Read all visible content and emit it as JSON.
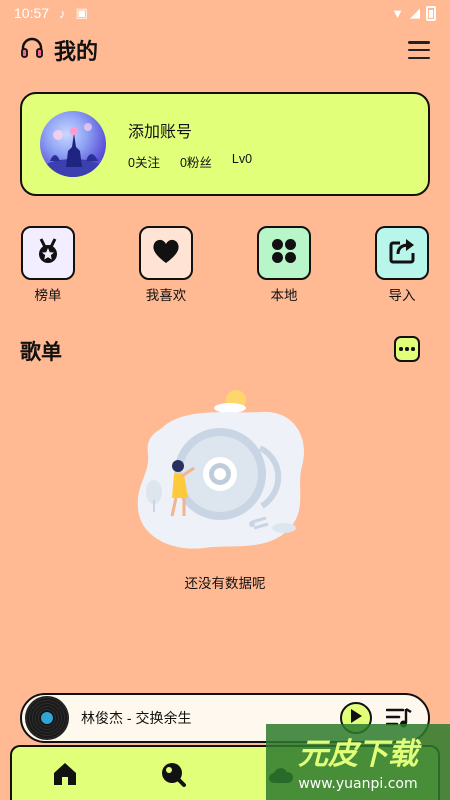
{
  "status_bar": {
    "time": "10:57"
  },
  "header": {
    "title": "我的"
  },
  "account": {
    "name": "添加账号",
    "following": "0关注",
    "fans": "0粉丝",
    "level": "Lv0"
  },
  "quick_actions": [
    {
      "label": "榜单",
      "icon": "medal-icon",
      "color": "#F3EEFF"
    },
    {
      "label": "我喜欢",
      "icon": "heart-icon",
      "color": "#FFE4D6"
    },
    {
      "label": "本地",
      "icon": "grid-icon",
      "color": "#B8F5C8"
    },
    {
      "label": "导入",
      "icon": "import-icon",
      "color": "#B8F5EA"
    }
  ],
  "playlists": {
    "title": "歌单",
    "empty_text": "还没有数据呢"
  },
  "player": {
    "song": "林俊杰 - 交换余生"
  },
  "watermark": {
    "brand": "元皮下载",
    "url": "www.yuanpi.com"
  },
  "colors": {
    "background": "#FFB993",
    "accent": "#E2FF7A",
    "border": "#111111"
  }
}
